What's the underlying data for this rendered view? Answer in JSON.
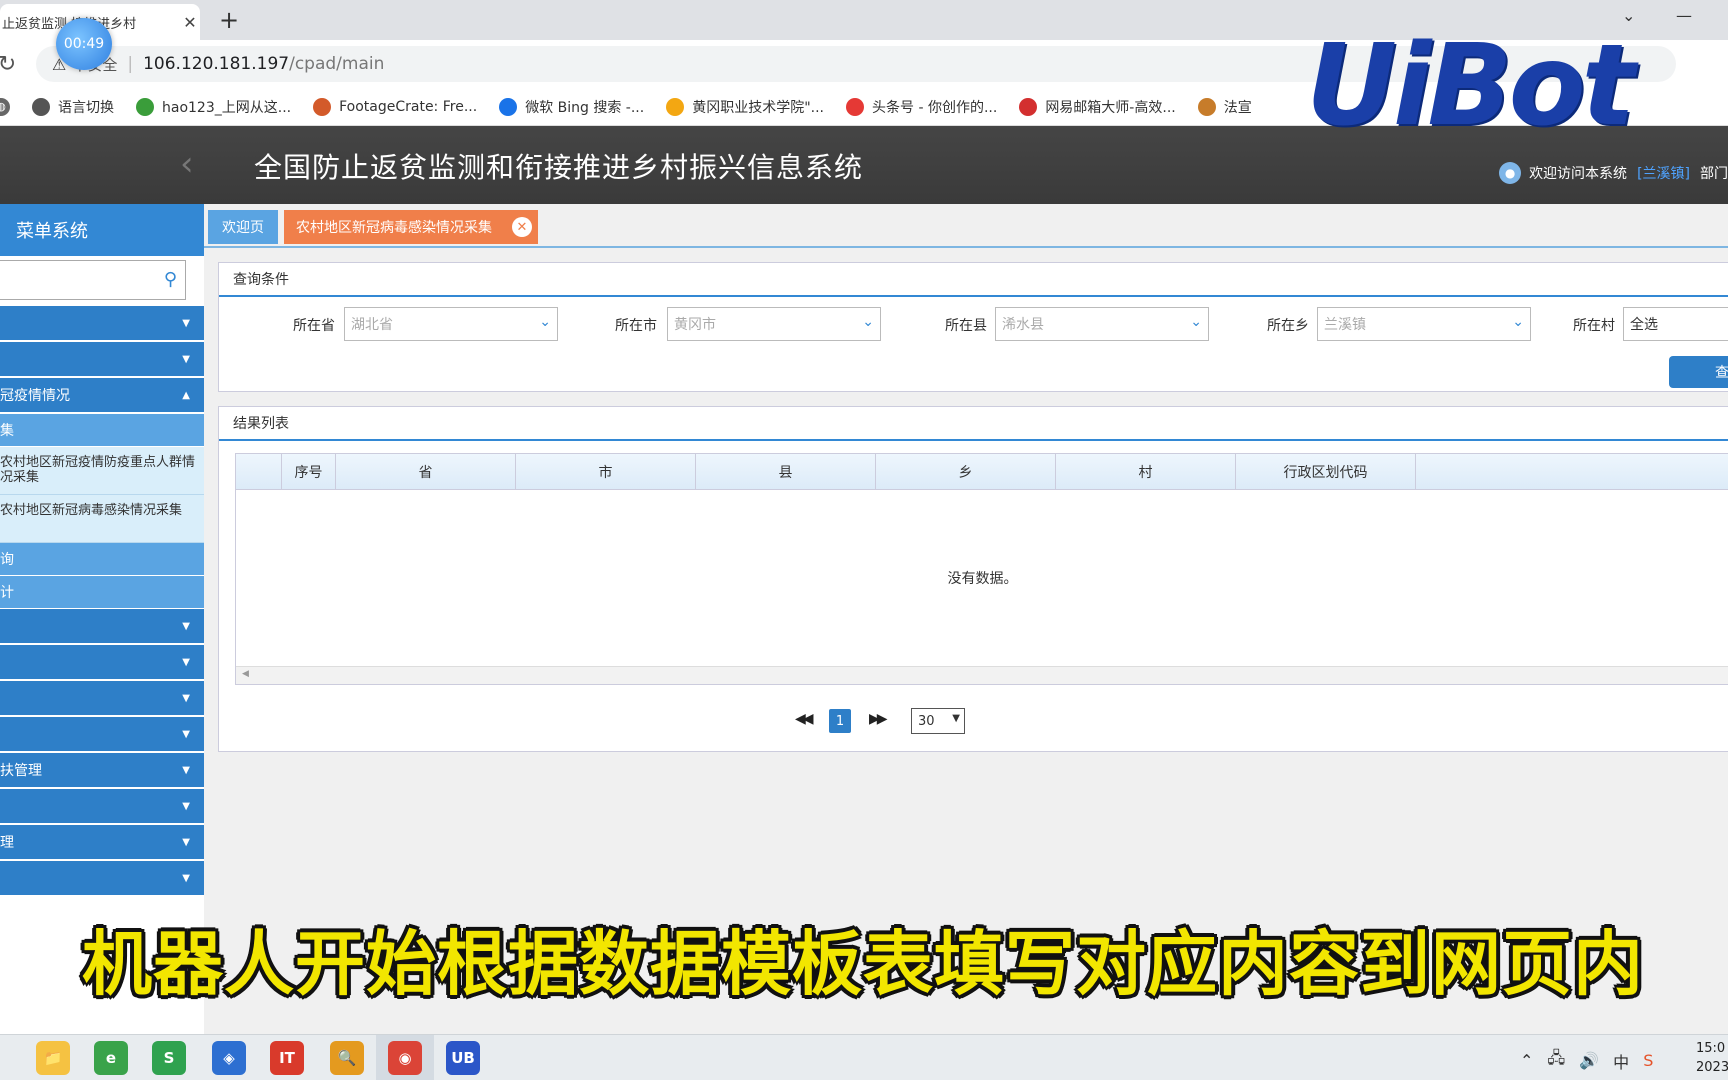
{
  "browser": {
    "tab_title": "止返贫监测   接推进乡村",
    "url_host": "106.120.181.197",
    "url_path": "/cpad/main",
    "insecure_label": "不安全",
    "timer": "00:49",
    "bookmarks": [
      {
        "label": "语言切换",
        "color": "#555555"
      },
      {
        "label": "hao123_上网从这...",
        "color": "#3a9d3a"
      },
      {
        "label": "FootageCrate: Fre...",
        "color": "#d35a2a"
      },
      {
        "label": "微软 Bing 搜索 -...",
        "color": "#1a73e8"
      },
      {
        "label": "黄冈职业技术学院\"...",
        "color": "#f3a712"
      },
      {
        "label": "头条号 - 你创作的...",
        "color": "#e53935"
      },
      {
        "label": "网易邮箱大师-高效...",
        "color": "#d32f2f"
      },
      {
        "label": "法宣",
        "color": "#c77c2a"
      }
    ]
  },
  "app": {
    "title": "全国防止返贫监测和衔接推进乡村振兴信息系统",
    "welcome_text": "欢迎访问本系统",
    "town": "[兰溪镇]",
    "dept": "部门"
  },
  "logo": {
    "text": "UiBot"
  },
  "sidebar": {
    "title": "菜单系统",
    "items": [
      {
        "label": "",
        "type": "item"
      },
      {
        "label": "",
        "type": "item"
      },
      {
        "label": "冠疫情情况",
        "type": "item-open"
      },
      {
        "label": "集",
        "type": "sub"
      },
      {
        "label": "农村地区新冠疫情防疫重点人群情况采集",
        "type": "leaf"
      },
      {
        "label": "农村地区新冠病毒感染情况采集",
        "type": "leaf"
      },
      {
        "label": "询",
        "type": "sub"
      },
      {
        "label": "计",
        "type": "sub"
      },
      {
        "label": "",
        "type": "item"
      },
      {
        "label": "",
        "type": "item"
      },
      {
        "label": "",
        "type": "item"
      },
      {
        "label": "",
        "type": "item"
      },
      {
        "label": "扶管理",
        "type": "item"
      },
      {
        "label": "",
        "type": "item"
      },
      {
        "label": "理",
        "type": "item"
      },
      {
        "label": "",
        "type": "item"
      }
    ]
  },
  "tabs": {
    "welcome": "欢迎页",
    "active": "农村地区新冠病毒感染情况采集"
  },
  "query": {
    "title": "查询条件",
    "province_label": "所在省",
    "province_value": "湖北省",
    "city_label": "所在市",
    "city_value": "黄冈市",
    "county_label": "所在县",
    "county_value": "浠水县",
    "town_label": "所在乡",
    "town_value": "兰溪镇",
    "village_label": "所在村",
    "village_value": "全选",
    "button": "查"
  },
  "results": {
    "title": "结果列表",
    "columns": [
      "序号",
      "省",
      "市",
      "县",
      "乡",
      "村",
      "行政区划代码"
    ],
    "empty_text": "没有数据。",
    "page": "1",
    "page_size": "30"
  },
  "caption": "机器人开始根据数据模板表填写对应内容到网页内",
  "taskbar": {
    "time": "15:0",
    "date": "2023/",
    "ime": "中",
    "apps": [
      {
        "name": "file-explorer",
        "label": "📁",
        "color": "#f5c242"
      },
      {
        "name": "ie-browser",
        "label": "e",
        "color": "#3aa34a"
      },
      {
        "name": "wps-sheet",
        "label": "S",
        "color": "#2fa24f"
      },
      {
        "name": "app-blue",
        "label": "◈",
        "color": "#2d6fd1"
      },
      {
        "name": "it-app",
        "label": "IT",
        "color": "#d93a2b"
      },
      {
        "name": "search-app",
        "label": "🔍",
        "color": "#e49a1f"
      },
      {
        "name": "chrome",
        "label": "◉",
        "color": "#db4437"
      },
      {
        "name": "uibot",
        "label": "UB",
        "color": "#2b56c8"
      }
    ]
  }
}
